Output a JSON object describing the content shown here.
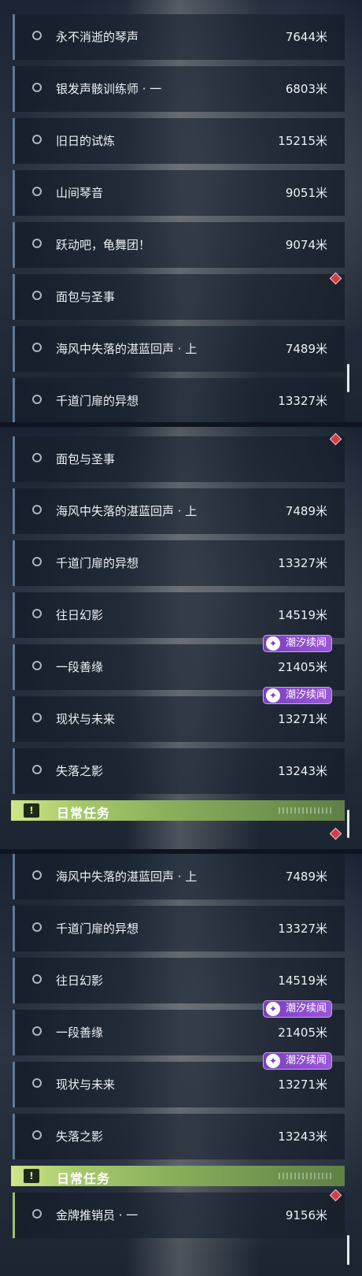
{
  "panels": [
    {
      "rows": [
        {
          "name": "永不消逝的琴声",
          "dist": "7644米"
        },
        {
          "name": "银发声骸训练师 · 一",
          "dist": "6803米"
        },
        {
          "name": "旧日的试炼",
          "dist": "15215米"
        },
        {
          "name": "山间琴音",
          "dist": "9051米"
        },
        {
          "name": "跃动吧，龟舞团！",
          "dist": "9074米"
        },
        {
          "name": "面包与圣事",
          "dist": ""
        },
        {
          "name": "海风中失落的湛蓝回声 · 上",
          "dist": "7489米"
        },
        {
          "name": "千道门扉的异想",
          "dist": "13327米"
        }
      ]
    },
    {
      "rows": [
        {
          "name": "面包与圣事",
          "dist": ""
        },
        {
          "name": "海风中失落的湛蓝回声 · 上",
          "dist": "7489米"
        },
        {
          "name": "千道门扉的异想",
          "dist": "13327米"
        },
        {
          "name": "往日幻影",
          "dist": "14519米"
        },
        {
          "name": "一段善缘",
          "dist": "21405米",
          "badge": "潮汐续闻"
        },
        {
          "name": "现状与未来",
          "dist": "13271米",
          "badge": "潮汐续闻"
        },
        {
          "name": "失落之影",
          "dist": "13243米"
        }
      ],
      "header": "日常任务"
    },
    {
      "rows": [
        {
          "name": "海风中失落的湛蓝回声 · 上",
          "dist": "7489米"
        },
        {
          "name": "千道门扉的异想",
          "dist": "13327米"
        },
        {
          "name": "往日幻影",
          "dist": "14519米"
        },
        {
          "name": "一段善缘",
          "dist": "21405米",
          "badge": "潮汐续闻"
        },
        {
          "name": "现状与未来",
          "dist": "13271米",
          "badge": "潮汐续闻"
        },
        {
          "name": "失落之影",
          "dist": "13243米"
        }
      ],
      "header": "日常任务",
      "daily_rows": [
        {
          "name": "金牌推销员 · 一",
          "dist": "9156米"
        }
      ]
    }
  ],
  "icons": {
    "row_icon": "circle-icon",
    "header_icon": "exclamation-icon",
    "badge_icon": "tide-icon",
    "marker_icon": "diamond-marker-icon"
  },
  "colors": {
    "badge": "#8a4bd0",
    "header_green": "#a6c96a",
    "marker_red": "#d43c4a"
  }
}
